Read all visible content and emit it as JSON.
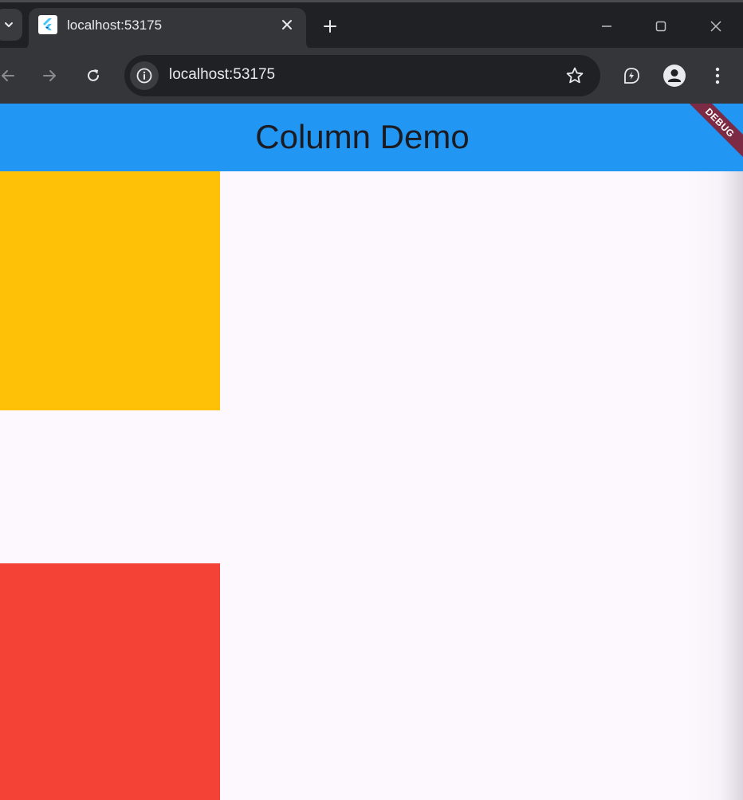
{
  "browser": {
    "tab": {
      "title": "localhost:53175"
    },
    "address_bar": {
      "url": "localhost:53175"
    }
  },
  "icons": {
    "tab_search": "chevron-down-icon",
    "favicon": "flutter-logo-icon",
    "tab_close": "close-icon",
    "new_tab": "plus-icon",
    "minimize": "minimize-icon",
    "maximize": "maximize-icon",
    "window_close": "close-icon",
    "back": "arrow-left-icon",
    "forward": "arrow-right-icon",
    "reload": "reload-icon",
    "site_info": "info-icon",
    "bookmark": "star-icon",
    "extension": "leaf-bolt-icon",
    "profile": "person-icon",
    "menu": "more-vert-icon"
  },
  "app": {
    "appbar": {
      "title": "Column Demo"
    },
    "debug_banner": "DEBUG",
    "boxes": [
      {
        "color": "#ffc107"
      },
      {
        "color": "#f44336"
      }
    ]
  },
  "colors": {
    "appbar": "#2196f3",
    "background": "#fdf7fe",
    "debug_banner": "#7d2a44"
  }
}
